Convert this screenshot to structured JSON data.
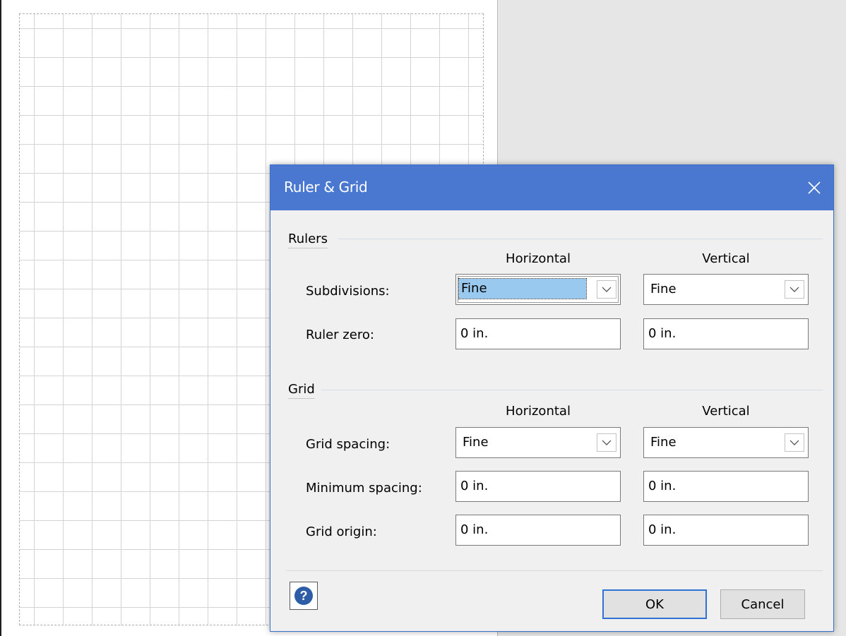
{
  "dialog": {
    "title": "Ruler & Grid",
    "close_icon": "close-icon",
    "rulers": {
      "section_label": "Rulers",
      "col_horizontal": "Horizontal",
      "col_vertical": "Vertical",
      "subdivisions_label": "Subdivisions:",
      "subdivisions_h": "Fine",
      "subdivisions_v": "Fine",
      "ruler_zero_label": "Ruler zero:",
      "ruler_zero_h": "0 in.",
      "ruler_zero_v": "0 in."
    },
    "grid": {
      "section_label": "Grid",
      "col_horizontal": "Horizontal",
      "col_vertical": "Vertical",
      "spacing_label": "Grid spacing:",
      "spacing_h": "Fine",
      "spacing_v": "Fine",
      "min_spacing_label": "Minimum spacing:",
      "min_spacing_h": "0 in.",
      "min_spacing_v": "0 in.",
      "origin_label": "Grid origin:",
      "origin_h": "0 in.",
      "origin_v": "0 in."
    },
    "buttons": {
      "ok": "OK",
      "cancel": "Cancel",
      "help_icon": "help-icon"
    },
    "colors": {
      "titlebar": "#4a78d1",
      "selection": "#99c9ef",
      "default_button_border": "#2f72d6"
    }
  }
}
